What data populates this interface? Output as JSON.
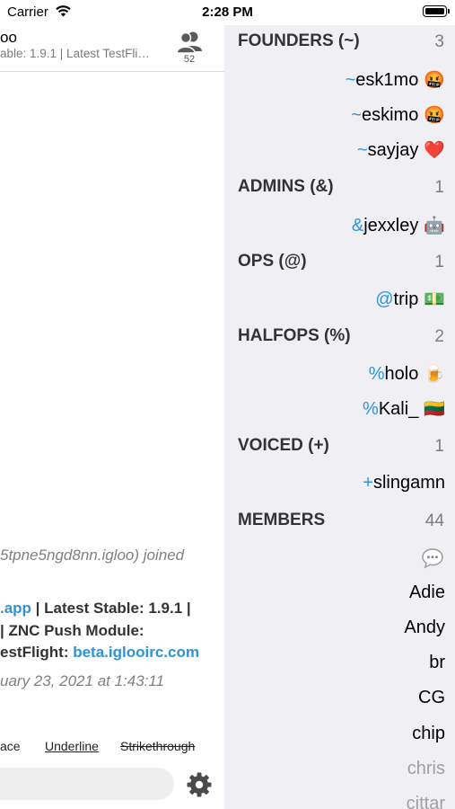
{
  "status_bar": {
    "carrier": "Carrier",
    "time": "2:28 PM"
  },
  "chat": {
    "title": "oo",
    "topic": "able: 1.9.1 | Latest TestFli…",
    "user_count": "52",
    "join_message": "5tpne5ngd8nn.igloo) joined",
    "motd_line1_link": ".app",
    "motd_line1_rest": " | Latest Stable: 1.9.1 |",
    "motd_line2": "| ZNC Push Module:",
    "motd_line3_prefix": "estFlight: ",
    "motd_line3_link": "beta.iglooirc.com",
    "date_message": "uary 23, 2021 at 1:43:11",
    "format_bar": {
      "space": "ace",
      "underline": "Underline",
      "strikethrough": "Strikethrough"
    },
    "input_placeholder": ""
  },
  "user_list": {
    "sections": [
      {
        "title": "FOUNDERS (~)",
        "count": "3",
        "users": [
          {
            "prefix": "~",
            "name": "esk1mo",
            "emoji": "🤬"
          },
          {
            "prefix": "~",
            "name": "eskimo",
            "emoji": "🤬"
          },
          {
            "prefix": "~",
            "name": "sayjay",
            "emoji": "❤️"
          }
        ]
      },
      {
        "title": "ADMINS (&)",
        "count": "1",
        "users": [
          {
            "prefix": "&",
            "name": "jexxley",
            "emoji": "🤖"
          }
        ]
      },
      {
        "title": "OPS (@)",
        "count": "1",
        "users": [
          {
            "prefix": "@",
            "name": "trip",
            "emoji": "💵"
          }
        ]
      },
      {
        "title": "HALFOPS (%)",
        "count": "2",
        "users": [
          {
            "prefix": "%",
            "name": "holo",
            "emoji": "🍺"
          },
          {
            "prefix": "%",
            "name": "Kali_",
            "emoji": "🇱🇹"
          }
        ]
      },
      {
        "title": "VOICED (+)",
        "count": "1",
        "users": [
          {
            "prefix": "+",
            "name": "slingamn",
            "emoji": ""
          }
        ]
      },
      {
        "title": "MEMBERS",
        "count": "44",
        "users": [
          {
            "name": "Adie"
          },
          {
            "name": "Andy"
          },
          {
            "name": "br"
          },
          {
            "name": "CG"
          },
          {
            "name": "chip"
          },
          {
            "name": "chris"
          },
          {
            "name": "cittar"
          }
        ]
      }
    ]
  },
  "colors": {
    "accent": "#2f93d8",
    "sidebar_bg": "#efeff4",
    "muted": "#808080"
  },
  "icons": {
    "wifi": "wifi-icon",
    "users": "users-icon",
    "gear": "gear-icon",
    "message_bubble": "speech-bubble-icon"
  }
}
